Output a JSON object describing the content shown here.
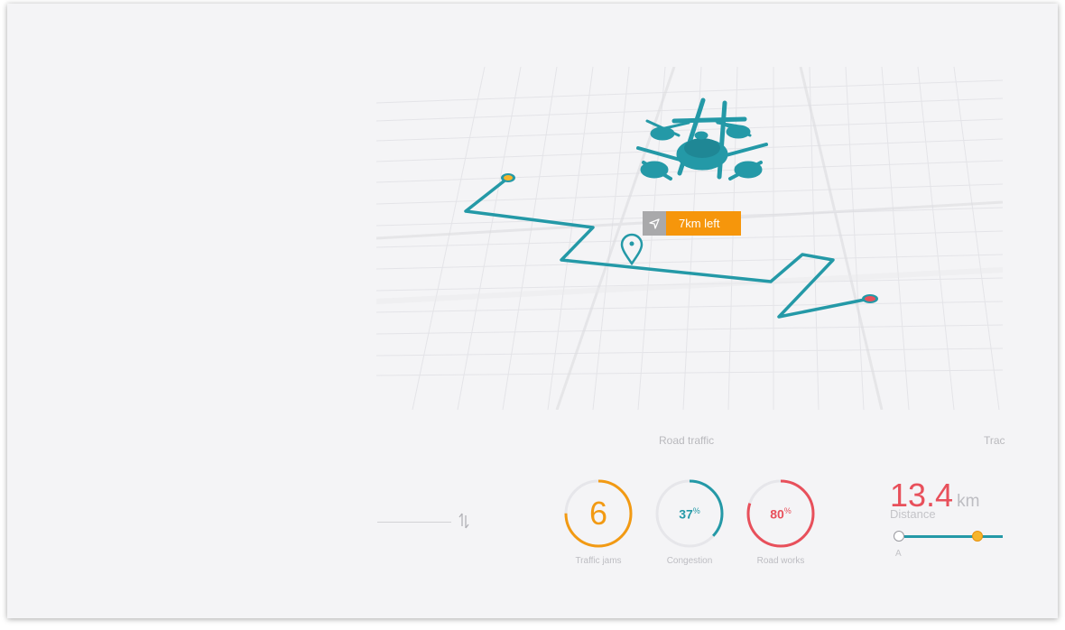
{
  "tooltip": {
    "label": "7km left",
    "icon": "navigation-arrow-icon"
  },
  "road_traffic": {
    "title": "Road traffic",
    "gauges": [
      {
        "value": "6",
        "caption": "Traffic jams",
        "fraction": 0.75,
        "color": "#f29a13"
      },
      {
        "value": "37",
        "unit": "%",
        "caption": "Congestion",
        "fraction": 0.37,
        "color": "#2499a7"
      },
      {
        "value": "80",
        "unit": "%",
        "caption": "Road works",
        "fraction": 0.8,
        "color": "#e8505b"
      }
    ]
  },
  "track": {
    "title": "Trac",
    "distance_value": "13.4",
    "distance_unit": "km",
    "distance_label": "Distance",
    "start_label": "A"
  },
  "colors": {
    "route": "#2499a7",
    "accent_orange": "#f6960b",
    "accent_red": "#e8505b",
    "background": "#f4f4f6"
  }
}
